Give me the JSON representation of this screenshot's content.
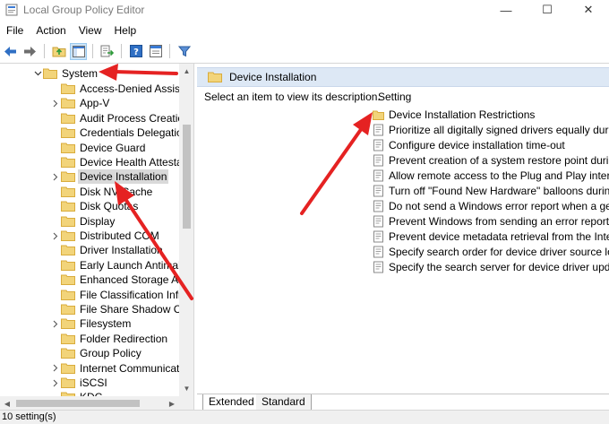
{
  "window": {
    "title": "Local Group Policy Editor",
    "minimize_glyph": "—",
    "maximize_glyph": "☐",
    "close_glyph": "✕"
  },
  "menu": [
    "File",
    "Action",
    "View",
    "Help"
  ],
  "toolbar_icons": [
    "back-arrow-icon",
    "forward-arrow-icon",
    "up-folder-icon",
    "show-hide-tree-icon",
    "export-list-icon",
    "help-icon",
    "properties-icon",
    "filter-icon"
  ],
  "tree": {
    "parent": "System",
    "items": [
      {
        "label": "Access-Denied Assistan",
        "expandable": false
      },
      {
        "label": "App-V",
        "expandable": true
      },
      {
        "label": "Audit Process Creation",
        "expandable": false
      },
      {
        "label": "Credentials Delegation",
        "expandable": false
      },
      {
        "label": "Device Guard",
        "expandable": false
      },
      {
        "label": "Device Health Attestati",
        "expandable": false
      },
      {
        "label": "Device Installation",
        "expandable": true,
        "selected": true
      },
      {
        "label": "Disk NV Cache",
        "expandable": false
      },
      {
        "label": "Disk Quotas",
        "expandable": false
      },
      {
        "label": "Display",
        "expandable": false
      },
      {
        "label": "Distributed COM",
        "expandable": true
      },
      {
        "label": "Driver Installation",
        "expandable": false
      },
      {
        "label": "Early Launch Antimalw",
        "expandable": false
      },
      {
        "label": "Enhanced Storage Acce",
        "expandable": false
      },
      {
        "label": "File Classification Infras",
        "expandable": false
      },
      {
        "label": "File Share Shadow Copy",
        "expandable": false
      },
      {
        "label": "Filesystem",
        "expandable": true
      },
      {
        "label": "Folder Redirection",
        "expandable": false
      },
      {
        "label": "Group Policy",
        "expandable": false
      },
      {
        "label": "Internet Communicatio",
        "expandable": true
      },
      {
        "label": "iSCSI",
        "expandable": true
      },
      {
        "label": "KDC",
        "expandable": false
      }
    ]
  },
  "right": {
    "header": "Device Installation",
    "description": "Select an item to view its description.",
    "column_header": "Setting",
    "settings": [
      {
        "label": "Device Installation Restrictions",
        "type": "folder"
      },
      {
        "label": "Prioritize all digitally signed drivers equally during t",
        "type": "policy"
      },
      {
        "label": "Configure device installation time-out",
        "type": "policy"
      },
      {
        "label": "Prevent creation of a system restore point during d",
        "type": "policy"
      },
      {
        "label": "Allow remote access to the Plug and Play interface",
        "type": "policy"
      },
      {
        "label": "Turn off \"Found New Hardware\" balloons during d",
        "type": "policy"
      },
      {
        "label": "Do not send a Windows error report when a generi",
        "type": "policy"
      },
      {
        "label": "Prevent Windows from sending an error report whe",
        "type": "policy"
      },
      {
        "label": "Prevent device metadata retrieval from the Internet",
        "type": "policy"
      },
      {
        "label": "Specify search order for device driver source locatio",
        "type": "policy"
      },
      {
        "label": "Specify the search server for device driver updates",
        "type": "policy"
      }
    ],
    "tabs": [
      "Extended",
      "Standard"
    ]
  },
  "status": "10 setting(s)",
  "colors": {
    "folder": "#f2d47a",
    "folder_dark": "#d9ac3c",
    "header_bg": "#dde8f5",
    "annotation_arrow": "#e52222"
  }
}
